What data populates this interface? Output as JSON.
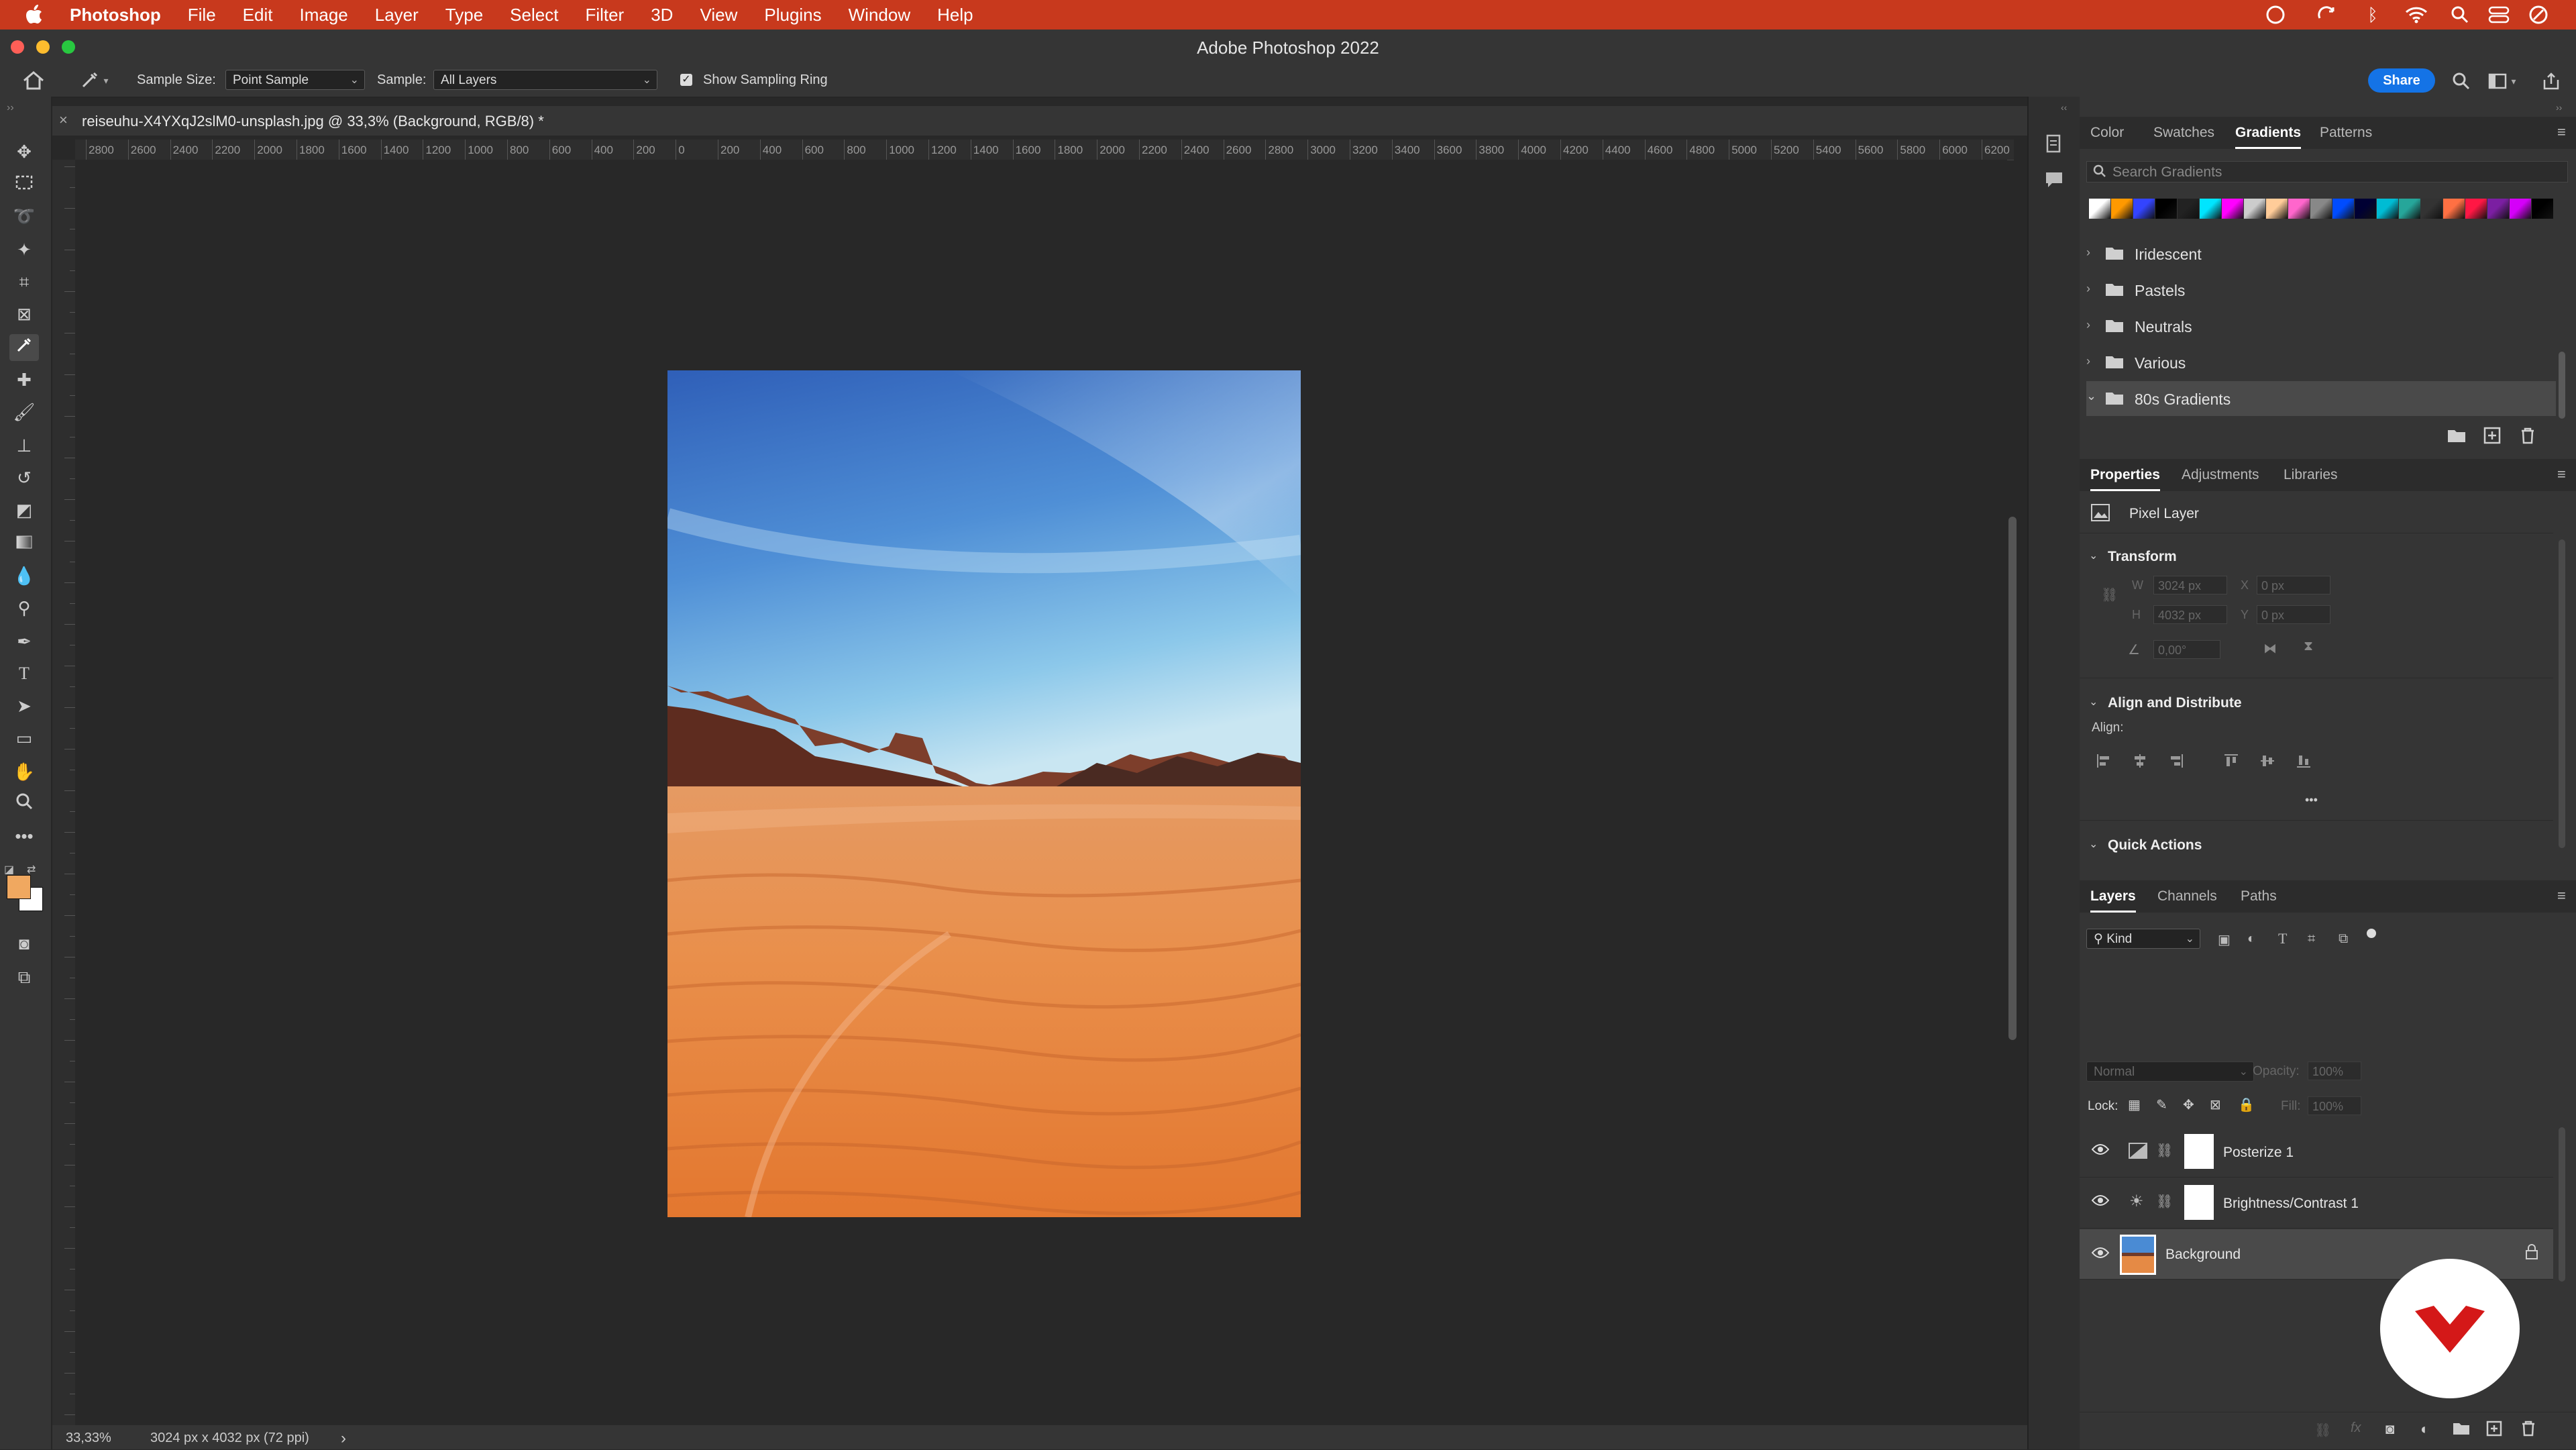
{
  "menubar": {
    "app_name": "Photoshop",
    "items": [
      "File",
      "Edit",
      "Image",
      "Layer",
      "Type",
      "Select",
      "Filter",
      "3D",
      "View",
      "Plugins",
      "Window",
      "Help"
    ]
  },
  "window": {
    "title": "Adobe Photoshop 2022"
  },
  "options": {
    "sample_size_label": "Sample Size:",
    "sample_size_value": "Point Sample",
    "sample_label": "Sample:",
    "sample_value": "All Layers",
    "show_ring_label": "Show Sampling Ring",
    "share_label": "Share"
  },
  "document": {
    "tab_title": "reiseuhu-X4YXqJ2slM0-unsplash.jpg @ 33,3% (Background, RGB/8) *",
    "ruler_labels": [
      "2800",
      "2600",
      "2400",
      "2200",
      "2000",
      "1800",
      "1600",
      "1400",
      "1200",
      "1000",
      "800",
      "600",
      "400",
      "200",
      "0",
      "200",
      "400",
      "600",
      "800",
      "1000",
      "1200",
      "1400",
      "1600",
      "1800",
      "2000",
      "2200",
      "2400",
      "2600",
      "2800",
      "3000",
      "3200",
      "3400",
      "3600",
      "3800",
      "4000",
      "4200",
      "4400",
      "4600",
      "4800",
      "5000",
      "5200",
      "5400",
      "5600",
      "5800",
      "6000",
      "6200"
    ]
  },
  "status": {
    "zoom": "33,33%",
    "doc_info": "3024 px x 4032 px (72 ppi)",
    "arrow": "›"
  },
  "gradients_panel": {
    "tabs": [
      "Color",
      "Swatches",
      "Gradients",
      "Patterns"
    ],
    "active_tab": "Gradients",
    "search_placeholder": "Search Gradients",
    "groups": [
      "Iridescent",
      "Pastels",
      "Neutrals",
      "Various",
      "80s Gradients"
    ],
    "swatch_colors": [
      "#ffffff",
      "#ff9900",
      "#3344ff",
      "#000000",
      "#222222",
      "#00e5ff",
      "#ff00ff",
      "#cccccc",
      "#ffcc99",
      "#ff66cc",
      "#888888",
      "#004cff",
      "#000033",
      "#00bcd4",
      "#26a69a",
      "#333333",
      "#ff7043",
      "#ff1744",
      "#7b1fa2",
      "#d500f9",
      "#000000"
    ]
  },
  "properties_panel": {
    "tabs": [
      "Properties",
      "Adjustments",
      "Libraries"
    ],
    "active_tab": "Properties",
    "layer_type": "Pixel Layer",
    "transform_label": "Transform",
    "w_label": "W",
    "w_value": "3024 px",
    "x_label": "X",
    "x_value": "0 px",
    "h_label": "H",
    "h_value": "4032 px",
    "y_label": "Y",
    "y_value": "0 px",
    "angle_value": "0,00°",
    "align_section": "Align and Distribute",
    "align_label": "Align:",
    "more": "•••",
    "quick_actions": "Quick Actions"
  },
  "layers_panel": {
    "tabs": [
      "Layers",
      "Channels",
      "Paths"
    ],
    "active_tab": "Layers",
    "kind_label": "Kind",
    "blend_mode": "Normal",
    "opacity_label": "Opacity:",
    "opacity_value": "100%",
    "lock_label": "Lock:",
    "fill_label": "Fill:",
    "fill_value": "100%",
    "layers": [
      {
        "name": "Posterize 1"
      },
      {
        "name": "Brightness/Contrast 1"
      },
      {
        "name": "Background"
      }
    ]
  },
  "colors": {
    "menubar": "#c8391d",
    "accent": "#1473e6",
    "foreground": "#f0a860",
    "background": "#ffffff"
  }
}
